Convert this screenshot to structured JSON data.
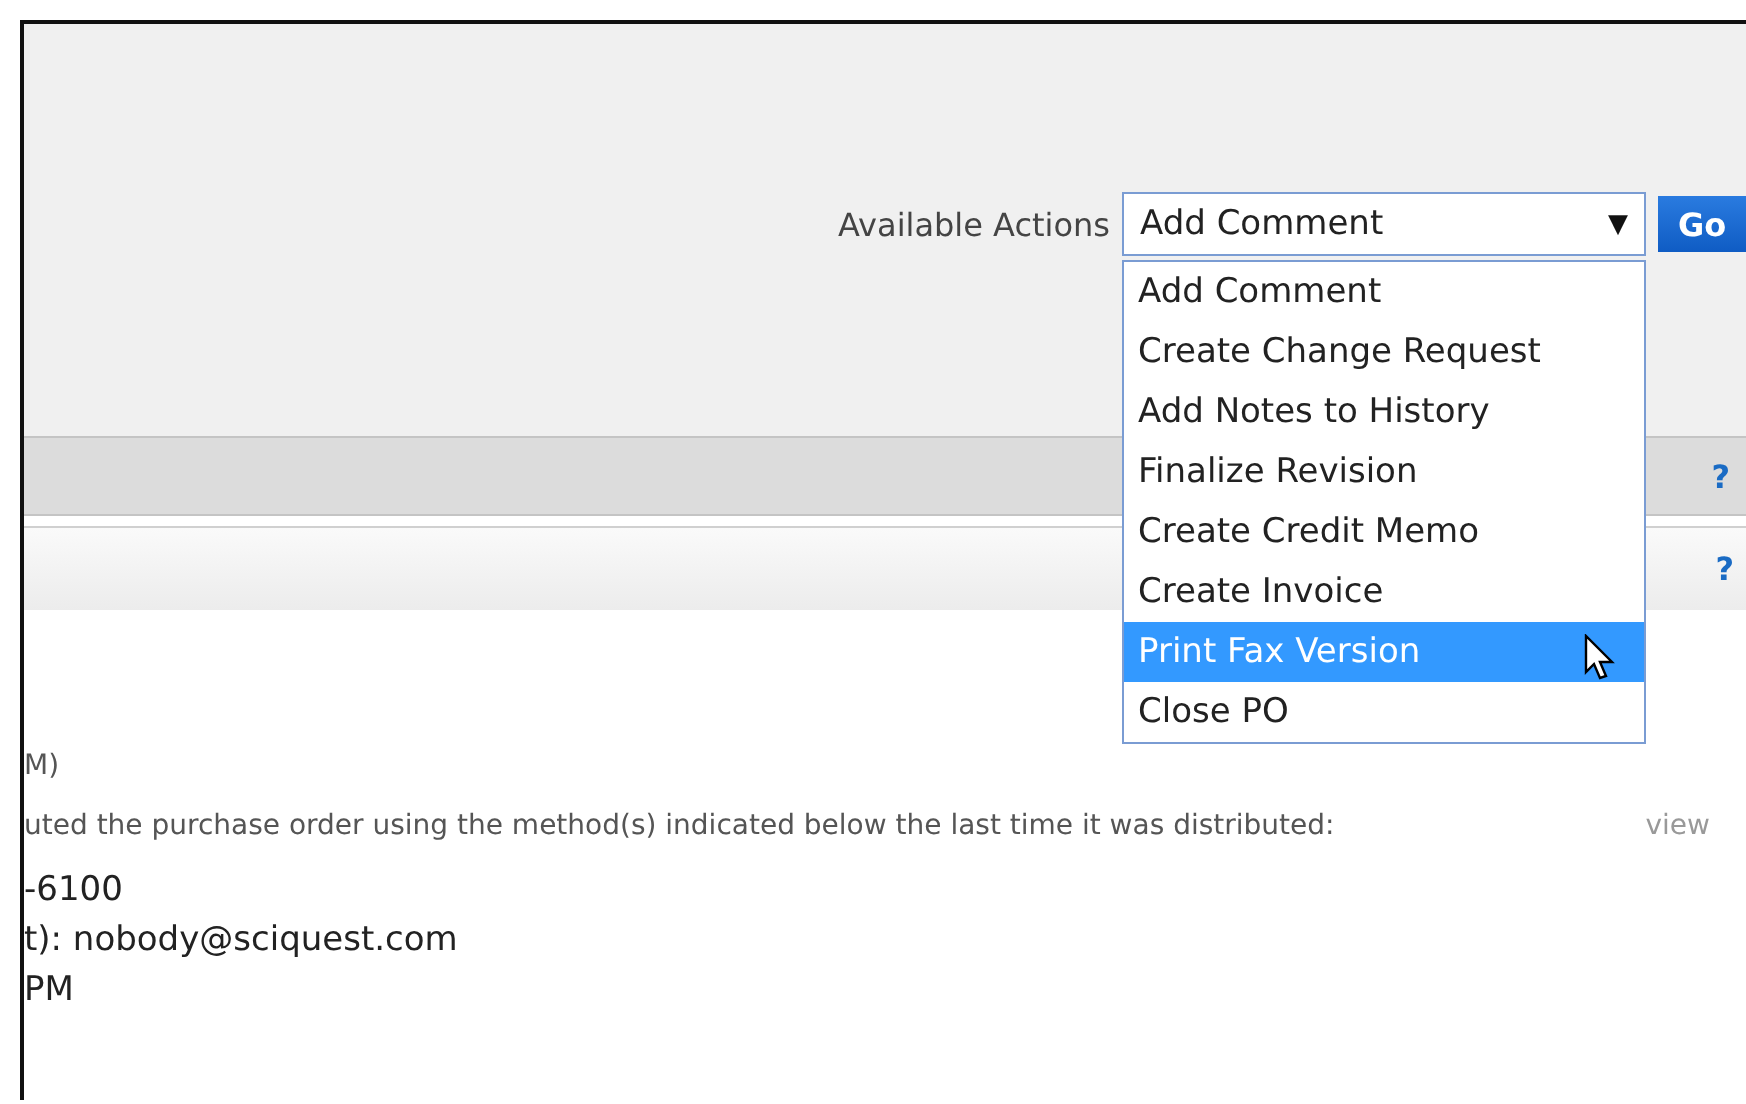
{
  "actions": {
    "label": "Available Actions",
    "select": {
      "value": "Add Comment",
      "arrow": "▼"
    },
    "go": "Go",
    "menu": [
      {
        "label": "Add Comment",
        "selected": false
      },
      {
        "label": "Create Change Request",
        "selected": false
      },
      {
        "label": "Add Notes to History",
        "selected": false
      },
      {
        "label": "Finalize Revision",
        "selected": false
      },
      {
        "label": "Create Credit Memo",
        "selected": false
      },
      {
        "label": "Create Invoice",
        "selected": false
      },
      {
        "label": "Print Fax Version",
        "selected": true
      },
      {
        "label": "Close PO",
        "selected": false
      }
    ]
  },
  "toolbar": {
    "help": "?"
  },
  "panel": {
    "help": "?",
    "lines": [
      {
        "kind": "note",
        "text": "M)"
      },
      {
        "kind": "note",
        "text": "uted the purchase order using the method(s) indicated below the last time it was distributed:",
        "link": "view"
      },
      {
        "kind": "value",
        "text": "-6100"
      },
      {
        "kind": "value",
        "text": "t): nobody@sciquest.com"
      },
      {
        "kind": "value",
        "text": "PM"
      }
    ]
  }
}
